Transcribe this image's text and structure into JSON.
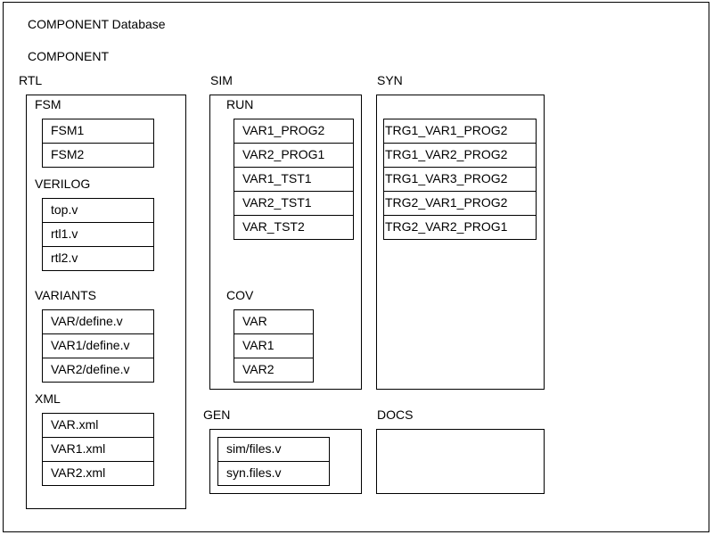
{
  "title": "COMPONENT Database",
  "component_label": "COMPONENT",
  "rtl": {
    "label": "RTL",
    "fsm": {
      "label": "FSM",
      "items": [
        "FSM1",
        "FSM2"
      ]
    },
    "verilog": {
      "label": "VERILOG",
      "items": [
        "top.v",
        "rtl1.v",
        "rtl2.v"
      ]
    },
    "variants": {
      "label": "VARIANTS",
      "items": [
        "VAR/define.v",
        "VAR1/define.v",
        "VAR2/define.v"
      ]
    },
    "xml": {
      "label": "XML",
      "items": [
        "VAR.xml",
        "VAR1.xml",
        "VAR2.xml"
      ]
    }
  },
  "sim": {
    "label": "SIM",
    "run": {
      "label": "RUN",
      "items": [
        "VAR1_PROG2",
        "VAR2_PROG1",
        "VAR1_TST1",
        "VAR2_TST1",
        "VAR_TST2"
      ]
    },
    "cov": {
      "label": "COV",
      "items": [
        "VAR",
        "VAR1",
        "VAR2"
      ]
    }
  },
  "syn": {
    "label": "SYN",
    "items": [
      "TRG1_VAR1_PROG2",
      "TRG1_VAR2_PROG2",
      "TRG1_VAR3_PROG2",
      "TRG2_VAR1_PROG2",
      "TRG2_VAR2_PROG1"
    ]
  },
  "gen": {
    "label": "GEN",
    "items": [
      "sim/files.v",
      "syn.files.v"
    ]
  },
  "docs": {
    "label": "DOCS"
  }
}
